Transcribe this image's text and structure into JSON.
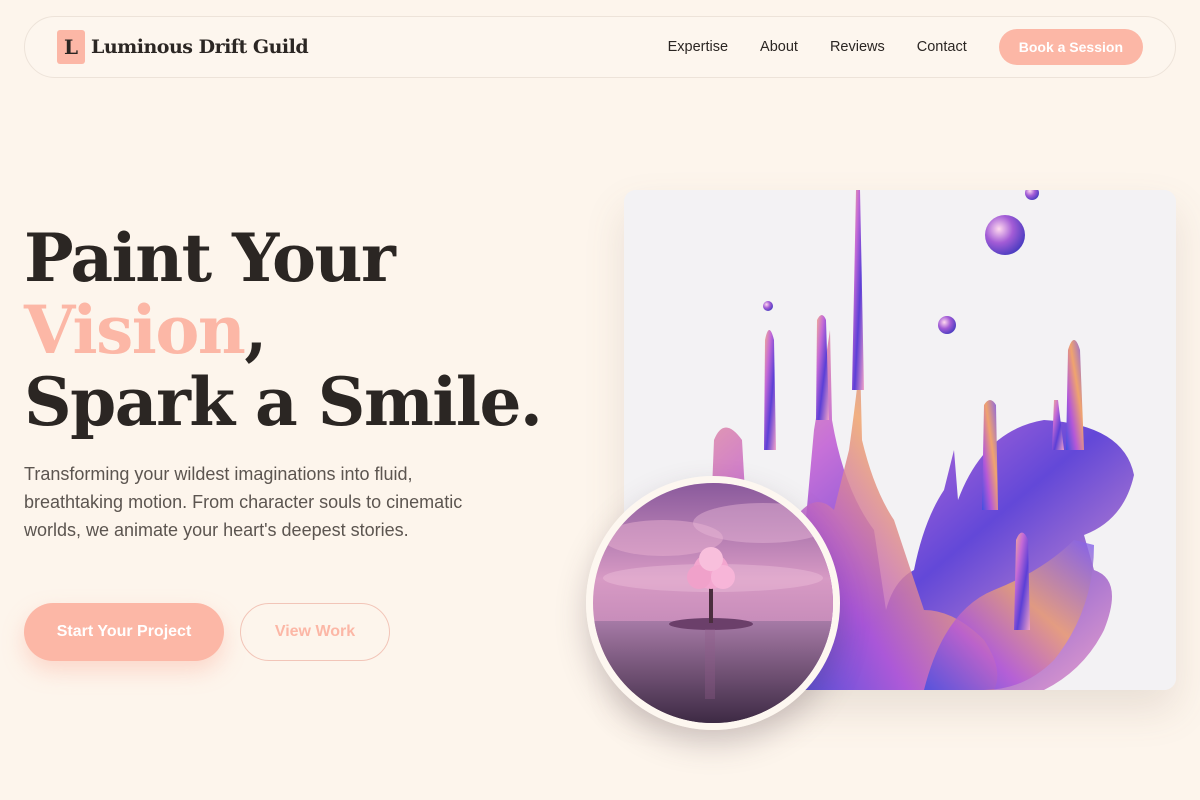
{
  "brand": {
    "mark": "L",
    "name": "Luminous Drift Guild"
  },
  "nav": {
    "links": [
      "Expertise",
      "About",
      "Reviews",
      "Contact"
    ],
    "cta": "Book a Session"
  },
  "hero": {
    "title_line1": "Paint Your",
    "title_accent": "Vision",
    "title_comma": ",",
    "title_line3": "Spark a Smile.",
    "subtitle": "Transforming your wildest imaginations into fluid, breathtaking motion. From character souls to cinematic worlds, we animate your heart's deepest stories.",
    "primary_cta": "Start Your Project",
    "secondary_cta": "View Work"
  },
  "images": {
    "main": "liquid-chrome-splash-image",
    "inset": "pink-tree-island-image"
  },
  "colors": {
    "background": "#fdf5ec",
    "accent": "#fcb7a6",
    "text": "#2b2623"
  }
}
